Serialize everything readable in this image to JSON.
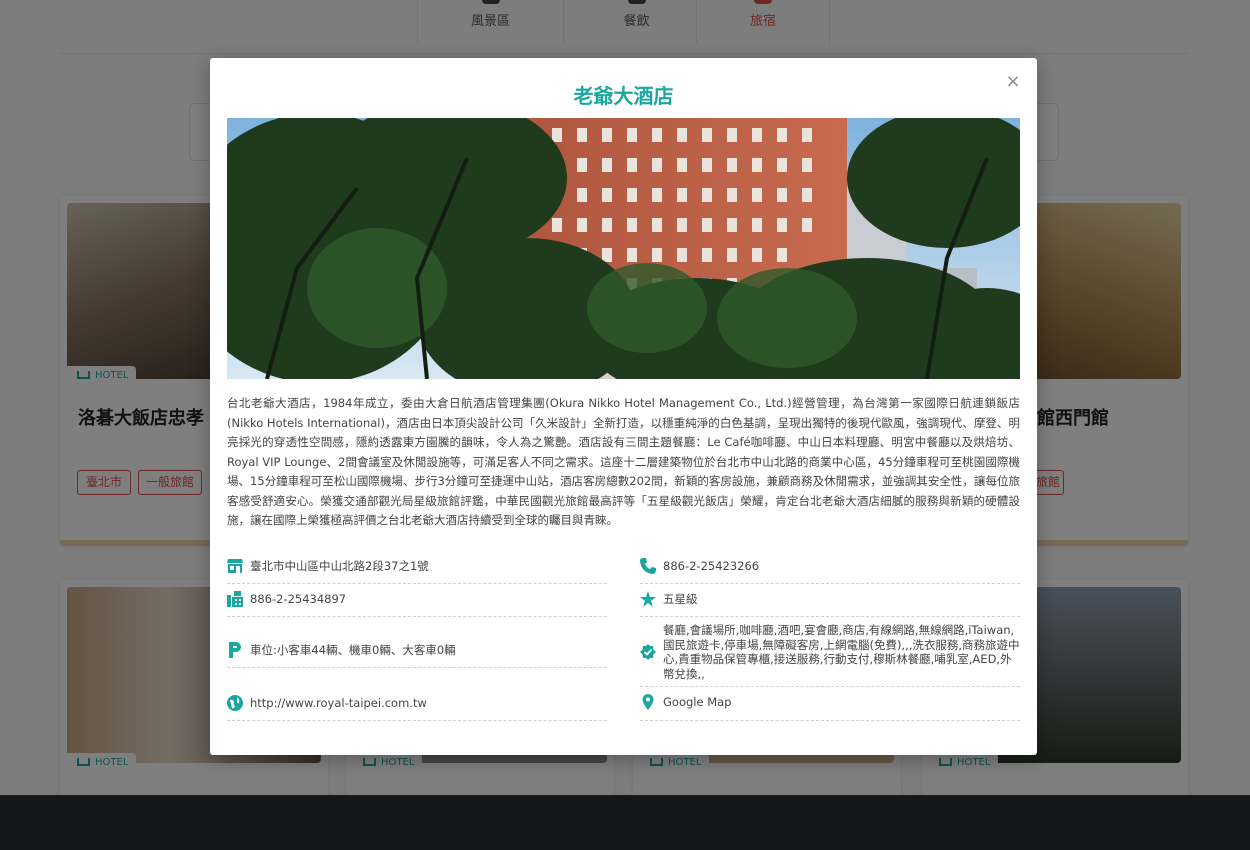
{
  "background": {
    "categories": [
      {
        "label": "風景區",
        "icon": "camera-icon",
        "active": false
      },
      {
        "label": "餐飲",
        "icon": "utensils-icon",
        "active": false
      },
      {
        "label": "旅宿",
        "icon": "bed-icon",
        "active": true
      }
    ],
    "cards": [
      {
        "tag": "HOTEL",
        "title": "洛碁大飯店忠孝",
        "chips": [
          "臺北市",
          "一般旅館"
        ]
      },
      {
        "tag": "HOTEL",
        "title": "館西門館",
        "chips": [
          "旅館"
        ]
      },
      {
        "tag": "HOTEL",
        "title": ""
      },
      {
        "tag": "HOTEL",
        "title": ""
      },
      {
        "tag": "HOTEL",
        "title": ""
      },
      {
        "tag": "HOTEL",
        "title": ""
      }
    ],
    "colors": {
      "accent": "#1ba7a0",
      "active_red": "#d9534f",
      "footer": "#2b3036"
    }
  },
  "modal": {
    "title": "老爺大酒店",
    "close_label": "×",
    "hero_image": "hotel-building-photo",
    "description": "台北老爺大酒店，1984年成立，委由大倉日航酒店管理集團(Okura Nikko Hotel Management Co., Ltd.)經營管理，為台灣第一家國際日航連鎖飯店(Nikko Hotels International)，酒店由日本頂尖設計公司「久米設計」全新打造，以穩重純淨的白色基調，呈現出獨特的後現代歐風，強調現代、摩登、明亮採光的穿透性空間感，隱約透露東方園騰的韻味，令人為之驚艷。酒店設有三間主題餐廳：Le Café咖啡廳、中山日本料理廳、明宮中餐廳以及烘焙坊、Royal VIP Lounge、2間會議室及休閒設施等，可滿足客人不同之需求。這座十二層建築物位於台北市中山北路的商業中心區，45分鐘車程可至桃園國際機場、15分鐘車程可至松山國際機場、步行3分鐘可至捷運中山站，酒店客房總數202間，新穎的客房設施，兼顧商務及休閒需求，並強調其安全性，讓每位旅客感受舒適安心。榮獲交通部觀光局星級旅館評鑑，中華民國觀光旅館最高評等「五星級觀光飯店」榮耀，肯定台北老爺大酒店細膩的服務與新穎的硬體設施，讓在國際上榮獲極高評價之台北老爺大酒店持續受到全球的矚目與青睞。",
    "info": {
      "address": "臺北市中山區中山北路2段37之1號",
      "fax": "886-2-25434897",
      "parking": "車位:小客車44輛、機車0輛、大客車0輛",
      "website": "http://www.royal-taipei.com.tw",
      "phone": "886-2-25423266",
      "grade": "五星級",
      "services": "餐廳,會議場所,咖啡廳,酒吧,宴會廳,商店,有線網路,無線網路,iTaiwan,國民旅遊卡,停車場,無障礙客房,上網電腦(免費),,,洗衣服務,商務旅遊中心,貴重物品保管專櫃,接送服務,行動支付,穆斯林餐廳,哺乳室,AED,外幣兌換,,",
      "map_link": "Google Map"
    }
  }
}
